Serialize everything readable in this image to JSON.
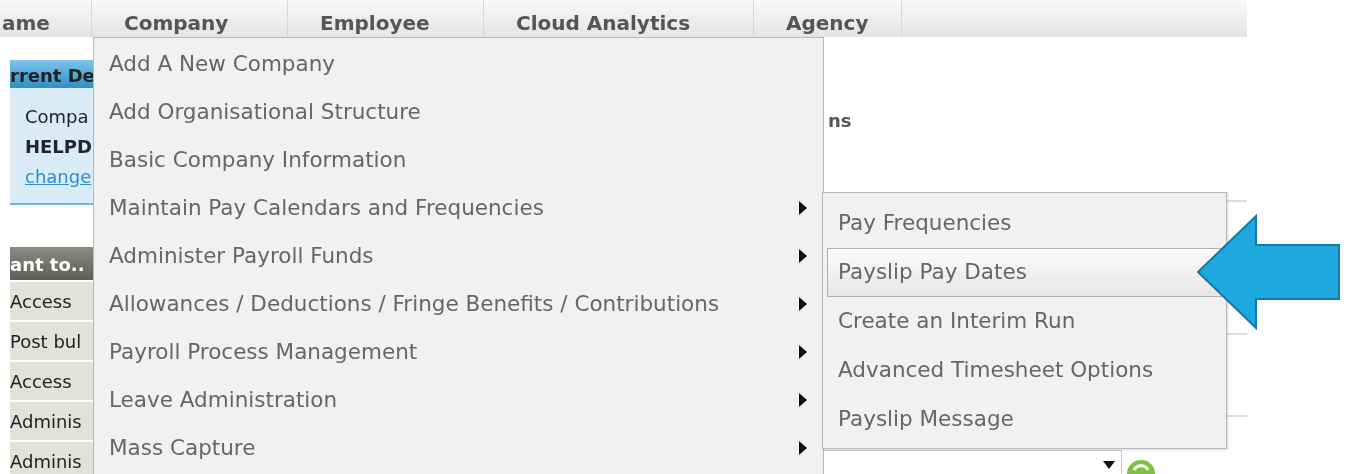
{
  "nav_tabs": [
    {
      "label": "ame"
    },
    {
      "label": "Company"
    },
    {
      "label": "Employee"
    },
    {
      "label": "Cloud Analytics"
    },
    {
      "label": "Agency"
    }
  ],
  "current_details": {
    "header": "rrent De",
    "lines": [
      "Compa",
      "HELPD"
    ],
    "link": "change"
  },
  "want_to": {
    "header": "ant to..",
    "items": [
      "Access",
      "Post bul",
      "Access",
      "Adminis",
      "Adminis"
    ]
  },
  "main": {
    "heading": "ns"
  },
  "company_menu": {
    "items": [
      {
        "label": "Add A New Company",
        "has_submenu": false
      },
      {
        "label": "Add Organisational Structure",
        "has_submenu": false
      },
      {
        "label": "Basic Company Information",
        "has_submenu": false
      },
      {
        "label": "Maintain Pay Calendars and Frequencies",
        "has_submenu": true
      },
      {
        "label": "Administer Payroll Funds",
        "has_submenu": true
      },
      {
        "label": "Allowances / Deductions / Fringe Benefits / Contributions",
        "has_submenu": true
      },
      {
        "label": "Payroll Process Management",
        "has_submenu": true
      },
      {
        "label": "Leave Administration",
        "has_submenu": true
      },
      {
        "label": "Mass Capture",
        "has_submenu": true
      }
    ]
  },
  "submenu": {
    "items": [
      {
        "label": "Pay Frequencies",
        "selected": false
      },
      {
        "label": "Payslip Pay Dates",
        "selected": true
      },
      {
        "label": "Create an Interim Run",
        "selected": false
      },
      {
        "label": "Advanced Timesheet Options",
        "selected": false
      },
      {
        "label": "Payslip Message",
        "selected": false
      }
    ]
  }
}
